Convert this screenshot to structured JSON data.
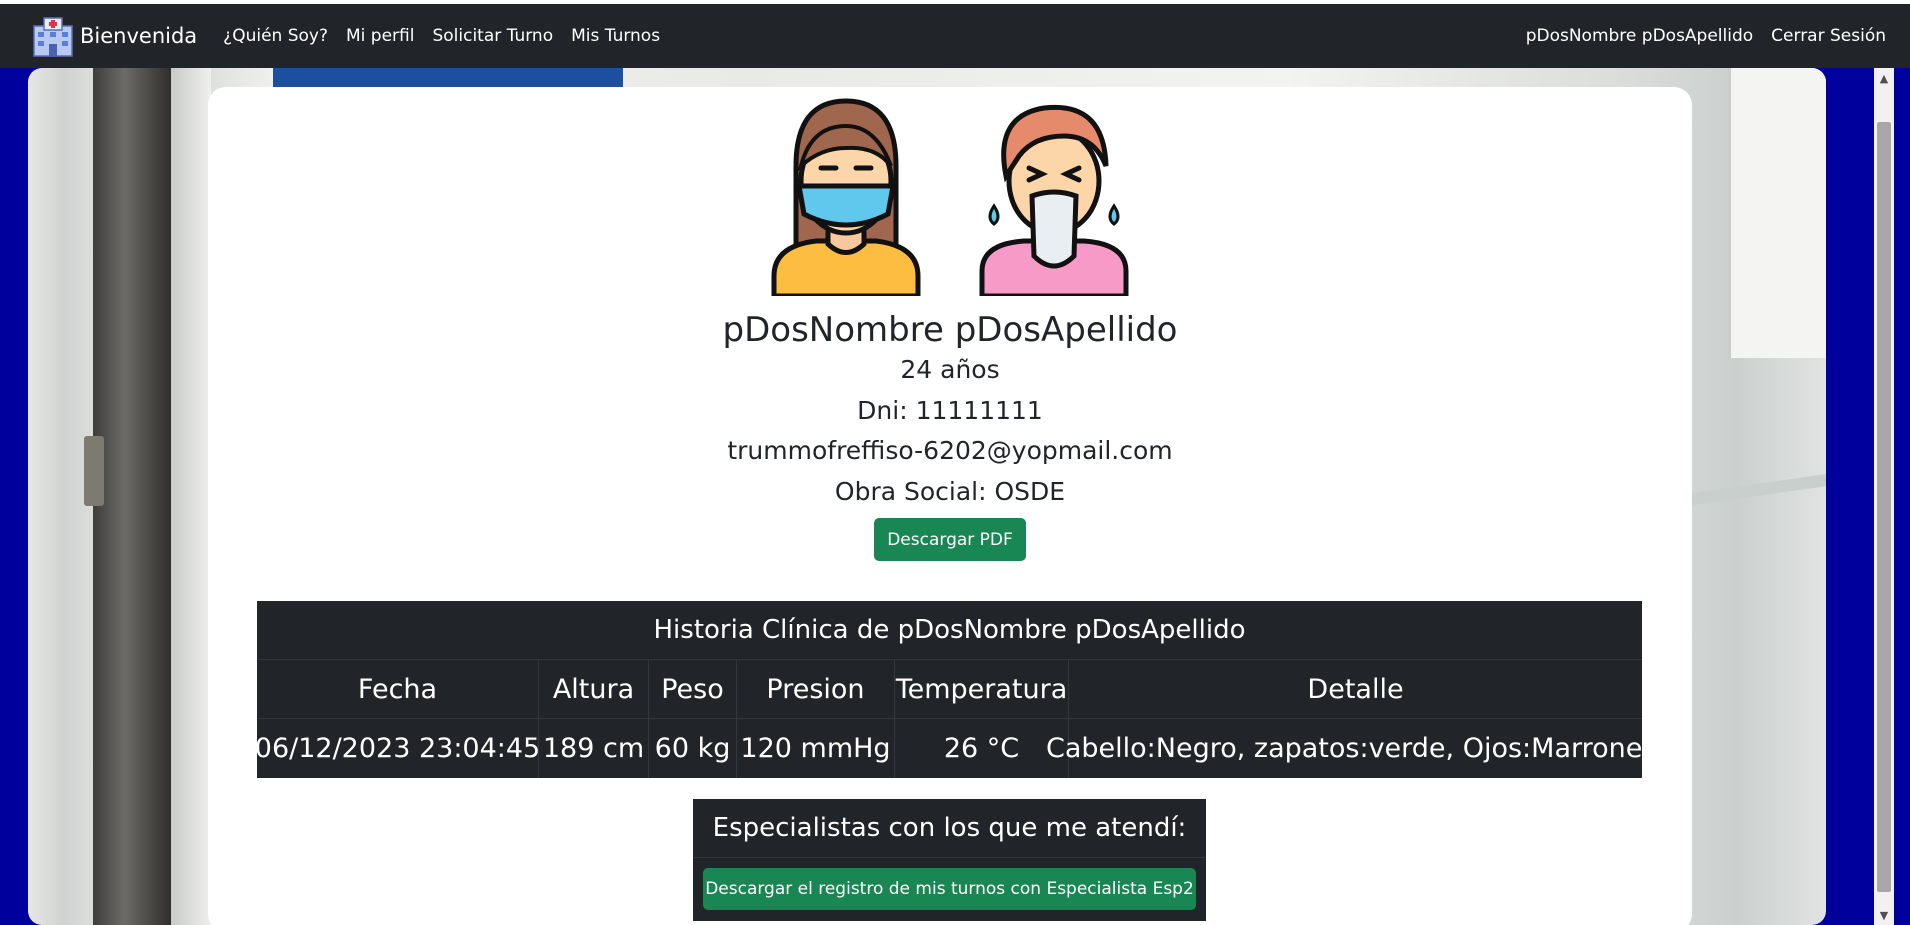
{
  "navbar": {
    "brand_label": "Bienvenida",
    "brand_icon": "hospital-icon",
    "links": [
      "¿Quién Soy?",
      "Mi perfil",
      "Solicitar Turno",
      "Mis Turnos"
    ],
    "user_name": "pDosNombre pDosApellido",
    "logout_label": "Cerrar Sesión"
  },
  "profile": {
    "avatar_icons": [
      "masked-woman-icon",
      "sick-man-icon"
    ],
    "full_name": "pDosNombre pDosApellido",
    "age": "24 años",
    "dni": "Dni: 11111111",
    "email": "trummofreffiso-6202@yopmail.com",
    "obra_social": "Obra Social: OSDE",
    "download_pdf_label": "Descargar PDF"
  },
  "historia": {
    "title": "Historia Clínica de pDosNombre pDosApellido",
    "headers": [
      "Fecha",
      "Altura",
      "Peso",
      "Presion",
      "Temperatura",
      "Detalle"
    ],
    "rows": [
      [
        "06/12/2023 23:04:45",
        "189 cm",
        "60 kg",
        "120 mmHg",
        "26 °C",
        "Cabello:Negro, zapatos:verde, Ojos:Marrones,"
      ]
    ]
  },
  "especialistas": {
    "title": "Especialistas con los que me atendí:",
    "buttons": [
      "Descargar el registro de mis turnos con Especialista Esp2"
    ]
  },
  "colors": {
    "navbar_bg": "#212529",
    "page_bg": "#00009c",
    "button_green": "#198754",
    "table_dark": "#212529"
  }
}
